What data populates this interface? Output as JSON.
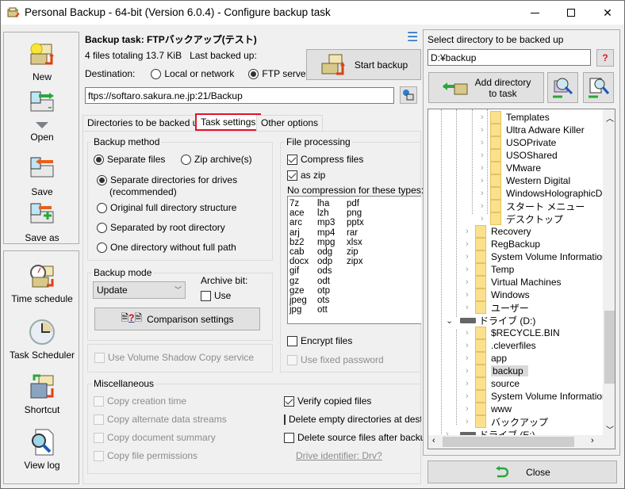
{
  "window": {
    "title": "Personal Backup - 64-bit (Version 6.0.4) - Configure backup task",
    "controls": {
      "minimize": "—",
      "maximize": "☐",
      "close": "✕"
    }
  },
  "toolbar": {
    "items": [
      {
        "label": "New",
        "icon": "new-task-icon"
      },
      {
        "label": "Open",
        "icon": "open-task-icon"
      },
      {
        "label": "Save",
        "icon": "save-task-icon"
      },
      {
        "label": "Save as",
        "icon": "save-as-icon"
      },
      {
        "label": "Time schedule",
        "icon": "stopwatch-icon"
      },
      {
        "label": "Task Scheduler",
        "icon": "clock-icon"
      },
      {
        "label": "Shortcut",
        "icon": "shortcut-icon"
      },
      {
        "label": "View log",
        "icon": "view-log-icon"
      }
    ]
  },
  "task": {
    "title": "Backup task: FTPバックアップ(テスト)",
    "summary": "4 files totaling 13.7 KiB   Last backed up:",
    "destination_label": "Destination:",
    "dest_local": "Local or network",
    "dest_ftp": "FTP server",
    "dest_selected": "FTP server",
    "url": "ftps://softaro.sakura.ne.jp:21/Backup",
    "start_backup": "Start backup",
    "menu_icon": "☰"
  },
  "tabs": [
    {
      "label": "Directories to be backed up",
      "active": false
    },
    {
      "label": "Task settings",
      "active": true
    },
    {
      "label": "Other options",
      "active": false
    }
  ],
  "backup_method": {
    "title": "Backup method",
    "separate_files": "Separate files",
    "zip_archive": "Zip archive(s)",
    "options": [
      {
        "label": "Separate directories for drives",
        "label2": "(recommended)",
        "checked": true
      },
      {
        "label": "Original full directory structure",
        "checked": false
      },
      {
        "label": "Separated by root directory",
        "checked": false
      },
      {
        "label": "One directory without full path",
        "checked": false
      }
    ]
  },
  "backup_mode": {
    "title": "Backup mode",
    "value": "Update",
    "archive_bit_label": "Archive bit:",
    "use_label": "Use",
    "comparison_settings": "Comparison settings"
  },
  "vss": {
    "label": "Use Volume Shadow Copy service"
  },
  "file_processing": {
    "title": "File processing",
    "compress_files": "Compress files",
    "as_zip": "as zip",
    "no_compression_label": "No compression for these types:",
    "types_col1": [
      "7z",
      "ace",
      "arc",
      "arj",
      "bz2",
      "cab",
      "docx",
      "gif",
      "gz",
      "gze",
      "jpeg",
      "jpg"
    ],
    "types_col2": [
      "lha",
      "lzh",
      "mp3",
      "mp4",
      "mpg",
      "odg",
      "odp",
      "ods",
      "odt",
      "otp",
      "ots",
      "ott"
    ],
    "types_col3": [
      "pdf",
      "png",
      "pptx",
      "rar",
      "xlsx",
      "zip",
      "zipx"
    ],
    "encrypt_files": "Encrypt files",
    "use_fixed_password": "Use fixed password"
  },
  "misc": {
    "title": "Miscellaneous",
    "left": [
      "Copy creation time",
      "Copy alternate data streams",
      "Copy document summary",
      "Copy file permissions"
    ],
    "verify": "Verify copied files",
    "delete_empty": "Delete empty directories at desti",
    "delete_source": "Delete source files after backup",
    "drive_identifier": "Drive identifier: Drv?"
  },
  "right": {
    "select_label": "Select directory to be backed up",
    "path": "D:¥backup",
    "help": "?",
    "add_dir_line1": "Add directory",
    "add_dir_line2": "to task",
    "close": "Close",
    "tree": [
      {
        "label": "Templates",
        "level": 3
      },
      {
        "label": "Ultra Adware Killer",
        "level": 3
      },
      {
        "label": "USOPrivate",
        "level": 3
      },
      {
        "label": "USOShared",
        "level": 3
      },
      {
        "label": "VMware",
        "level": 3
      },
      {
        "label": "Western Digital",
        "level": 3
      },
      {
        "label": "WindowsHolographicDev",
        "level": 3
      },
      {
        "label": "スタート メニュー",
        "level": 3
      },
      {
        "label": "デスクトップ",
        "level": 3
      },
      {
        "label": "Recovery",
        "level": 2
      },
      {
        "label": "RegBackup",
        "level": 2
      },
      {
        "label": "System Volume Information",
        "level": 2
      },
      {
        "label": "Temp",
        "level": 2
      },
      {
        "label": "Virtual Machines",
        "level": 2
      },
      {
        "label": "Windows",
        "level": 2
      },
      {
        "label": "ユーザー",
        "level": 2
      },
      {
        "label": "ドライブ (D:)",
        "level": 1,
        "drive": true,
        "expanded": true
      },
      {
        "label": "$RECYCLE.BIN",
        "level": 2
      },
      {
        "label": ".cleverfiles",
        "level": 2
      },
      {
        "label": "app",
        "level": 2
      },
      {
        "label": "backup",
        "level": 2,
        "selected": true
      },
      {
        "label": "source",
        "level": 2
      },
      {
        "label": "System Volume Information",
        "level": 2
      },
      {
        "label": "www",
        "level": 2
      },
      {
        "label": "バックアップ",
        "level": 2
      },
      {
        "label": "ドライブ (E:)",
        "level": 1,
        "drive": true
      }
    ]
  },
  "colors": {
    "highlight_red": "#e81123",
    "accent_blue": "#1f6dbf"
  }
}
